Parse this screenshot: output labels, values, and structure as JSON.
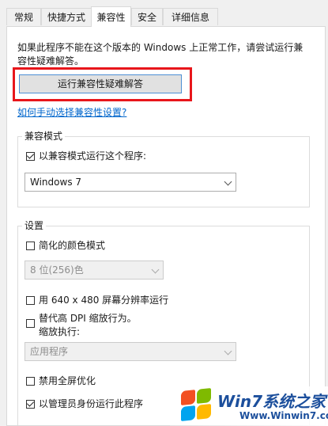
{
  "tabs": [
    "常规",
    "快捷方式",
    "兼容性",
    "安全",
    "详细信息"
  ],
  "description": "如果此程序不能在这个版本的 Windows 上正常工作，请尝试运行兼容性疑难解答。",
  "run_troubleshooter_label": "运行兼容性疑难解答",
  "manual_link": "如何手动选择兼容性设置?",
  "compat_mode": {
    "title": "兼容模式",
    "checkbox_label": "以兼容模式运行这个程序:",
    "checked": true,
    "selected_os": "Windows 7"
  },
  "settings": {
    "title": "设置",
    "reduced_color_label": "简化的颜色模式",
    "color_select": "8 位(256)色",
    "resolution_label": "用 640 x 480 屏幕分辨率运行",
    "dpi_label_line1": "替代高 DPI 缩放行为。",
    "dpi_label_line2": "缩放执行:",
    "dpi_select": "应用程序",
    "fullscreen_label": "禁用全屏优化",
    "admin_label": "以管理员身份运行此程序"
  },
  "watermark": {
    "title": "Win7系统之家",
    "url": "Www.Winwin7.com",
    "logo_colors": [
      "#f25022",
      "#7fba00",
      "#00a4ef",
      "#ffb900"
    ]
  }
}
